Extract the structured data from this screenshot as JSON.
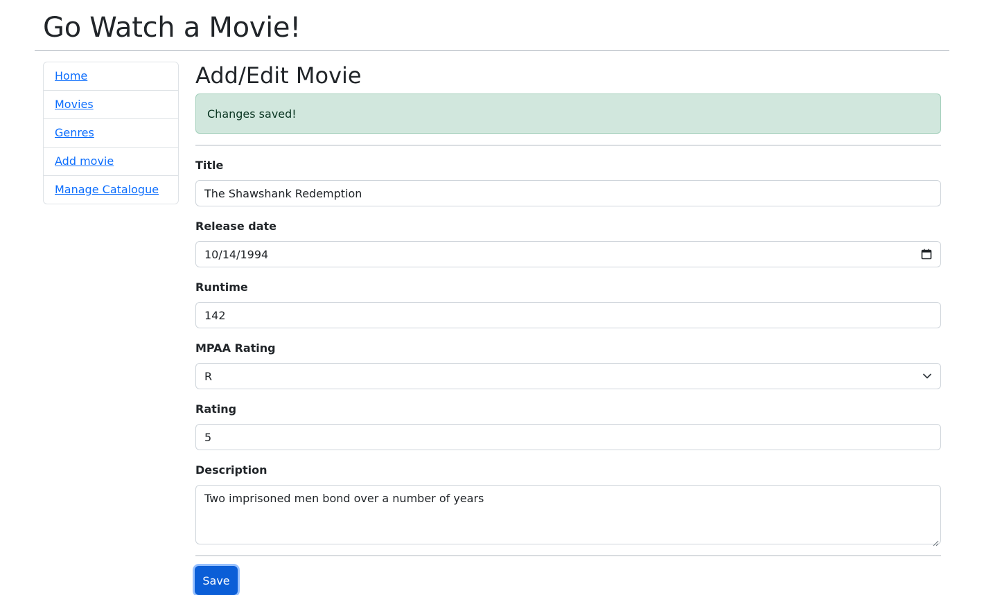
{
  "app": {
    "title": "Go Watch a Movie!"
  },
  "sidebar": {
    "items": [
      {
        "label": "Home"
      },
      {
        "label": "Movies"
      },
      {
        "label": "Genres"
      },
      {
        "label": "Add movie"
      },
      {
        "label": "Manage Catalogue"
      }
    ]
  },
  "page": {
    "title": "Add/Edit Movie"
  },
  "alert": {
    "message": "Changes saved!"
  },
  "form": {
    "title": {
      "label": "Title",
      "value": "The Shawshank Redemption"
    },
    "release_date": {
      "label": "Release date",
      "value": "10/14/1994",
      "icon": "calendar-icon"
    },
    "runtime": {
      "label": "Runtime",
      "value": "142"
    },
    "mpaa_rating": {
      "label": "MPAA Rating",
      "value": "R",
      "icon": "chevron-down-icon"
    },
    "rating": {
      "label": "Rating",
      "value": "5"
    },
    "description": {
      "label": "Description",
      "value": "Two imprisoned men bond over a number of years"
    },
    "save_label": "Save"
  },
  "colors": {
    "link": "#0d6efd",
    "alert_bg": "#d1e7dd",
    "alert_text": "#0a3622",
    "button_bg": "#0b5ed7"
  }
}
